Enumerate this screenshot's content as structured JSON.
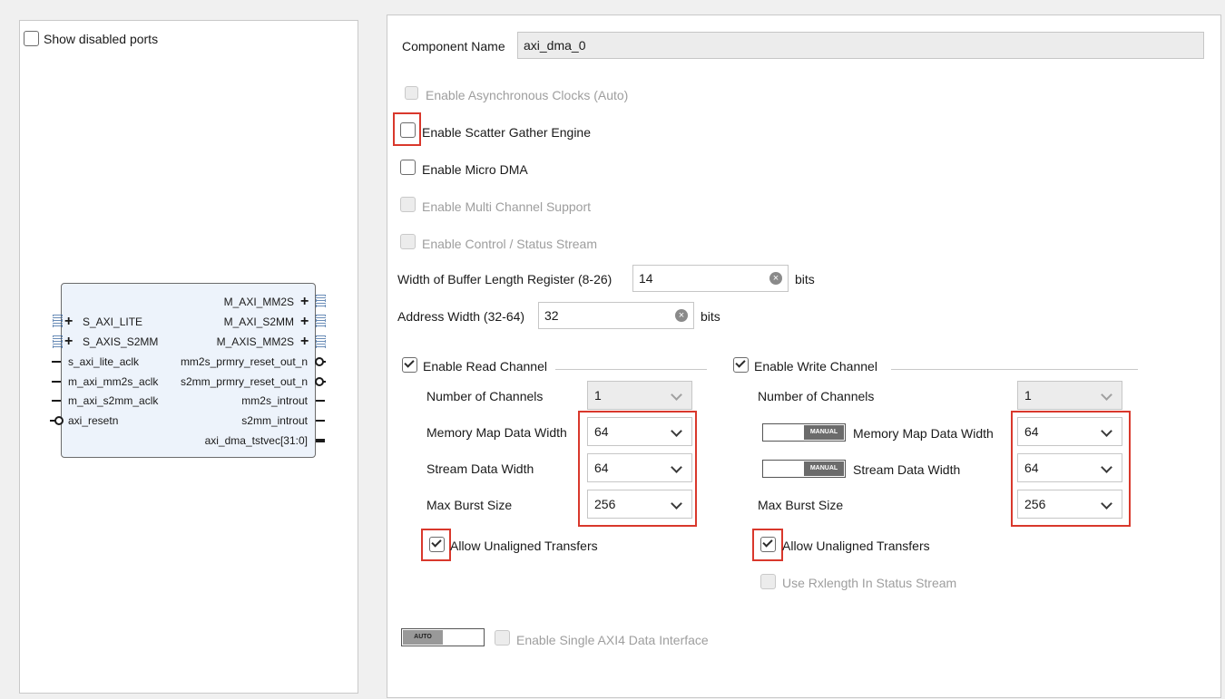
{
  "left_panel": {
    "show_disabled_ports": "Show disabled ports",
    "ip_block": {
      "left_ports": [
        "S_AXI_LITE",
        "S_AXIS_S2MM",
        "s_axi_lite_aclk",
        "m_axi_mm2s_aclk",
        "m_axi_s2mm_aclk",
        "axi_resetn"
      ],
      "right_ports": [
        "M_AXI_MM2S",
        "M_AXI_S2MM",
        "M_AXIS_MM2S",
        "mm2s_prmry_reset_out_n",
        "s2mm_prmry_reset_out_n",
        "mm2s_introut",
        "s2mm_introut",
        "axi_dma_tstvec[31:0]"
      ]
    }
  },
  "config": {
    "component_name_label": "Component Name",
    "component_name_value": "axi_dma_0",
    "async_clocks": "Enable Asynchronous Clocks (Auto)",
    "scatter_gather": "Enable Scatter Gather Engine",
    "micro_dma": "Enable Micro DMA",
    "multi_channel": "Enable Multi Channel Support",
    "control_status": "Enable Control / Status Stream",
    "buffer_length_label": "Width of Buffer Length Register (8-26)",
    "buffer_length_value": "14",
    "address_width_label": "Address Width (32-64)",
    "address_width_value": "32",
    "bits": "bits",
    "read_channel": {
      "title": "Enable Read Channel",
      "num_channels_label": "Number of Channels",
      "num_channels_value": "1",
      "mm_width_label": "Memory Map Data Width",
      "mm_width_value": "64",
      "stream_width_label": "Stream Data Width",
      "stream_width_value": "64",
      "burst_label": "Max Burst Size",
      "burst_value": "256",
      "unaligned": "Allow Unaligned Transfers"
    },
    "write_channel": {
      "title": "Enable Write Channel",
      "num_channels_label": "Number of Channels",
      "num_channels_value": "1",
      "mm_width_label": "Memory Map Data Width",
      "mm_width_value": "64",
      "stream_width_label": "Stream Data Width",
      "stream_width_value": "64",
      "burst_label": "Max Burst Size",
      "burst_value": "256",
      "unaligned": "Allow Unaligned Transfers",
      "rxlength": "Use Rxlength In Status Stream",
      "manual": "MANUAL"
    },
    "auto_toggle": "AUTO",
    "single_axi4": "Enable Single AXI4 Data Interface"
  },
  "colors": {
    "highlight": "#d9382c",
    "ip_fill": "#edf3fb"
  }
}
